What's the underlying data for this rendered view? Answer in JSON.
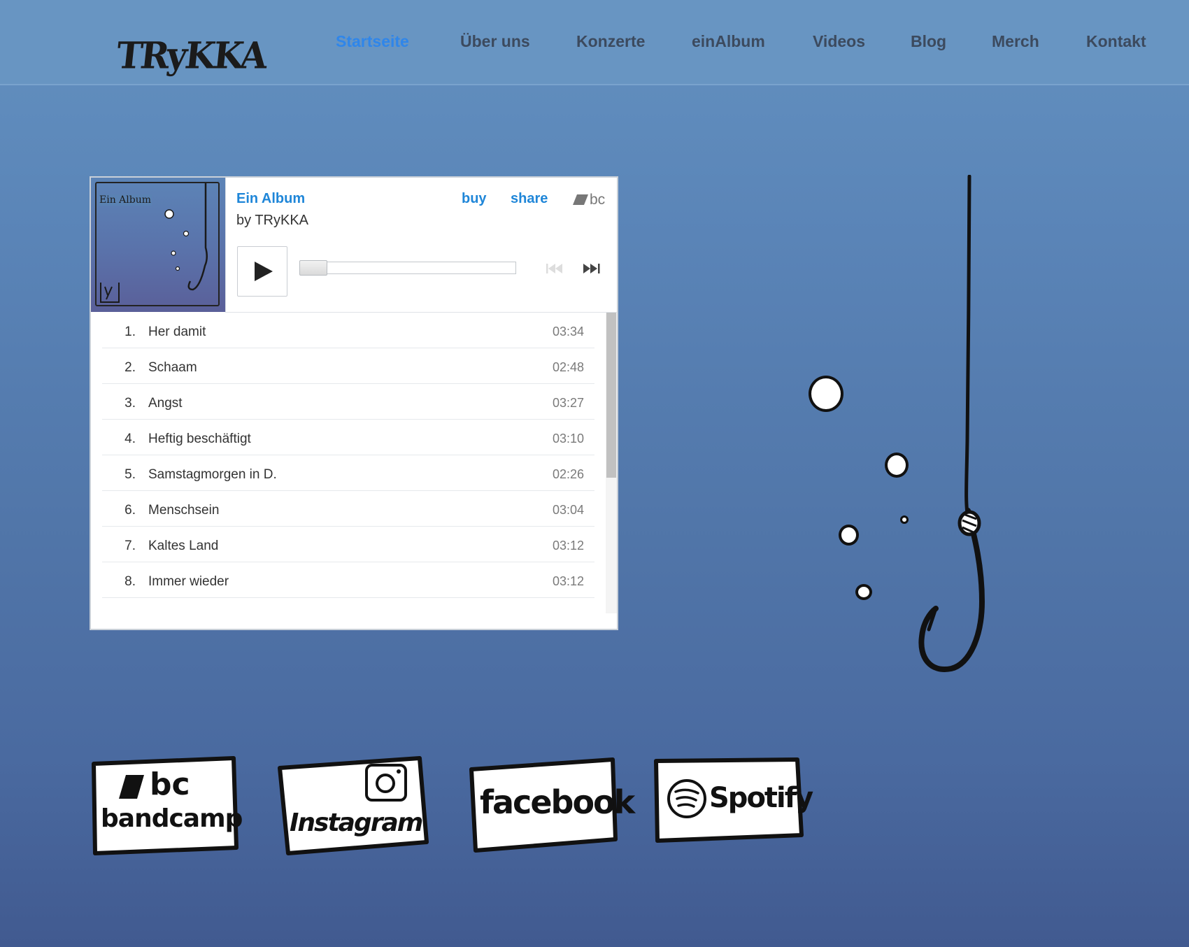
{
  "header": {
    "logo_text": "TRyKKA",
    "nav": [
      {
        "label": "Startseite",
        "active": true
      },
      {
        "label": "Über uns",
        "active": false
      },
      {
        "label": "Konzerte",
        "active": false
      },
      {
        "label": "einAlbum",
        "active": false
      },
      {
        "label": "Videos",
        "active": false
      },
      {
        "label": "Blog",
        "active": false
      },
      {
        "label": "Merch",
        "active": false
      },
      {
        "label": "Kontakt",
        "active": false
      }
    ]
  },
  "player": {
    "cover_title": "Ein Album",
    "album_title": "Ein Album",
    "artist": "by TRyKKA",
    "buy_label": "buy",
    "share_label": "share",
    "bc_label": "bc",
    "progress_fraction": 0,
    "tracks": [
      {
        "num": "1.",
        "title": "Her damit",
        "time": "03:34"
      },
      {
        "num": "2.",
        "title": "Schaam",
        "time": "02:48"
      },
      {
        "num": "3.",
        "title": "Angst",
        "time": "03:27"
      },
      {
        "num": "4.",
        "title": "Heftig beschäftigt",
        "time": "03:10"
      },
      {
        "num": "5.",
        "title": "Samstagmorgen in D.",
        "time": "02:26"
      },
      {
        "num": "6.",
        "title": "Menschsein",
        "time": "03:04"
      },
      {
        "num": "7.",
        "title": "Kaltes Land",
        "time": "03:12"
      },
      {
        "num": "8.",
        "title": "Immer wieder",
        "time": "03:12"
      }
    ]
  },
  "social": {
    "bandcamp_top": "bc",
    "bandcamp_bottom": "bandcamp",
    "instagram": "Instagram",
    "facebook": "facebook",
    "spotify": "Spotify"
  },
  "colors": {
    "accent": "#2f86ea",
    "nav_text": "#3c4a5e",
    "link": "#1f86d8",
    "header_bg": "#6895c2"
  }
}
